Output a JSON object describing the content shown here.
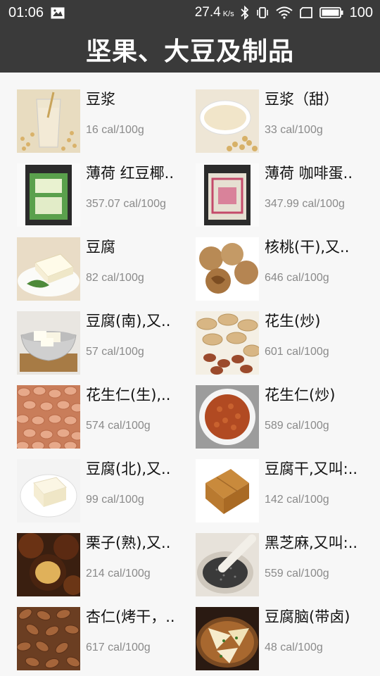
{
  "status": {
    "time": "01:06",
    "speed": "27.4",
    "speed_unit": "K/s",
    "battery": "100"
  },
  "header": {
    "title": "坚果、大豆及制品"
  },
  "items": [
    {
      "name": "豆浆",
      "cal": "16 cal/100g",
      "thumb": "soymilk-glass"
    },
    {
      "name": "豆浆（甜）",
      "cal": "33 cal/100g",
      "thumb": "soymilk-bowl"
    },
    {
      "name": "薄荷 红豆椰..",
      "cal": "357.07 cal/100g",
      "thumb": "green-package"
    },
    {
      "name": "薄荷 咖啡蛋..",
      "cal": "347.99 cal/100g",
      "thumb": "pink-package"
    },
    {
      "name": "豆腐",
      "cal": "82 cal/100g",
      "thumb": "tofu-plate"
    },
    {
      "name": "核桃(干),又..",
      "cal": "646 cal/100g",
      "thumb": "walnuts"
    },
    {
      "name": "豆腐(南),又..",
      "cal": "57 cal/100g",
      "thumb": "tofu-bowl"
    },
    {
      "name": "花生(炒)",
      "cal": "601 cal/100g",
      "thumb": "peanuts-shell"
    },
    {
      "name": "花生仁(生),..",
      "cal": "574 cal/100g",
      "thumb": "peanut-kernels"
    },
    {
      "name": "花生仁(炒)",
      "cal": "589 cal/100g",
      "thumb": "roasted-peanuts-dish"
    },
    {
      "name": "豆腐(北),又..",
      "cal": "99 cal/100g",
      "thumb": "tofu-block-plate"
    },
    {
      "name": "豆腐干,又叫:..",
      "cal": "142 cal/100g",
      "thumb": "dried-tofu"
    },
    {
      "name": "栗子(熟),又..",
      "cal": "214 cal/100g",
      "thumb": "chestnuts"
    },
    {
      "name": "黑芝麻,又叫:..",
      "cal": "559 cal/100g",
      "thumb": "black-sesame-mortar"
    },
    {
      "name": "杏仁(烤干，..",
      "cal": "617 cal/100g",
      "thumb": "almonds"
    },
    {
      "name": "豆腐脑(带卤)",
      "cal": "48 cal/100g",
      "thumb": "tofu-pudding"
    }
  ]
}
